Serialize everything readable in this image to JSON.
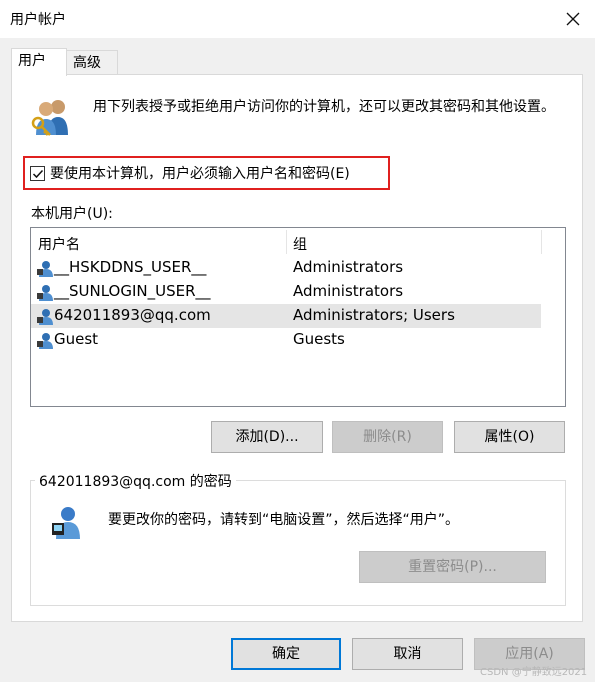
{
  "window": {
    "title": "用户帐户"
  },
  "tabs": [
    {
      "label": "用户"
    },
    {
      "label": "高级"
    }
  ],
  "intro_text": "用下列表授予或拒绝用户访问你的计算机，还可以更改其密码和其他设置。",
  "require_login": {
    "checked": true,
    "label": "要使用本计算机，用户必须输入用户名和密码(E)"
  },
  "local_users_label": "本机用户(U):",
  "list": {
    "columns": [
      "用户名",
      "组"
    ],
    "rows": [
      {
        "name": "__HSKDDNS_USER__",
        "group": "Administrators"
      },
      {
        "name": "__SUNLOGIN_USER__",
        "group": "Administrators"
      },
      {
        "name": "642011893@qq.com",
        "group": "Administrators; Users",
        "selected": true
      },
      {
        "name": "Guest",
        "group": "Guests"
      }
    ]
  },
  "buttons": {
    "add": "添加(D)...",
    "remove": "删除(R)",
    "properties": "属性(O)",
    "reset_password": "重置密码(P)...",
    "ok": "确定",
    "cancel": "取消",
    "apply": "应用(A)"
  },
  "password_group": {
    "title": "642011893@qq.com 的密码",
    "text": "要更改你的密码，请转到“电脑设置”，然后选择“用户”。"
  },
  "watermark": "CSDN @宁静致远2021",
  "colors": {
    "highlight": "#e0201f",
    "default_button_border": "#0078d7"
  }
}
